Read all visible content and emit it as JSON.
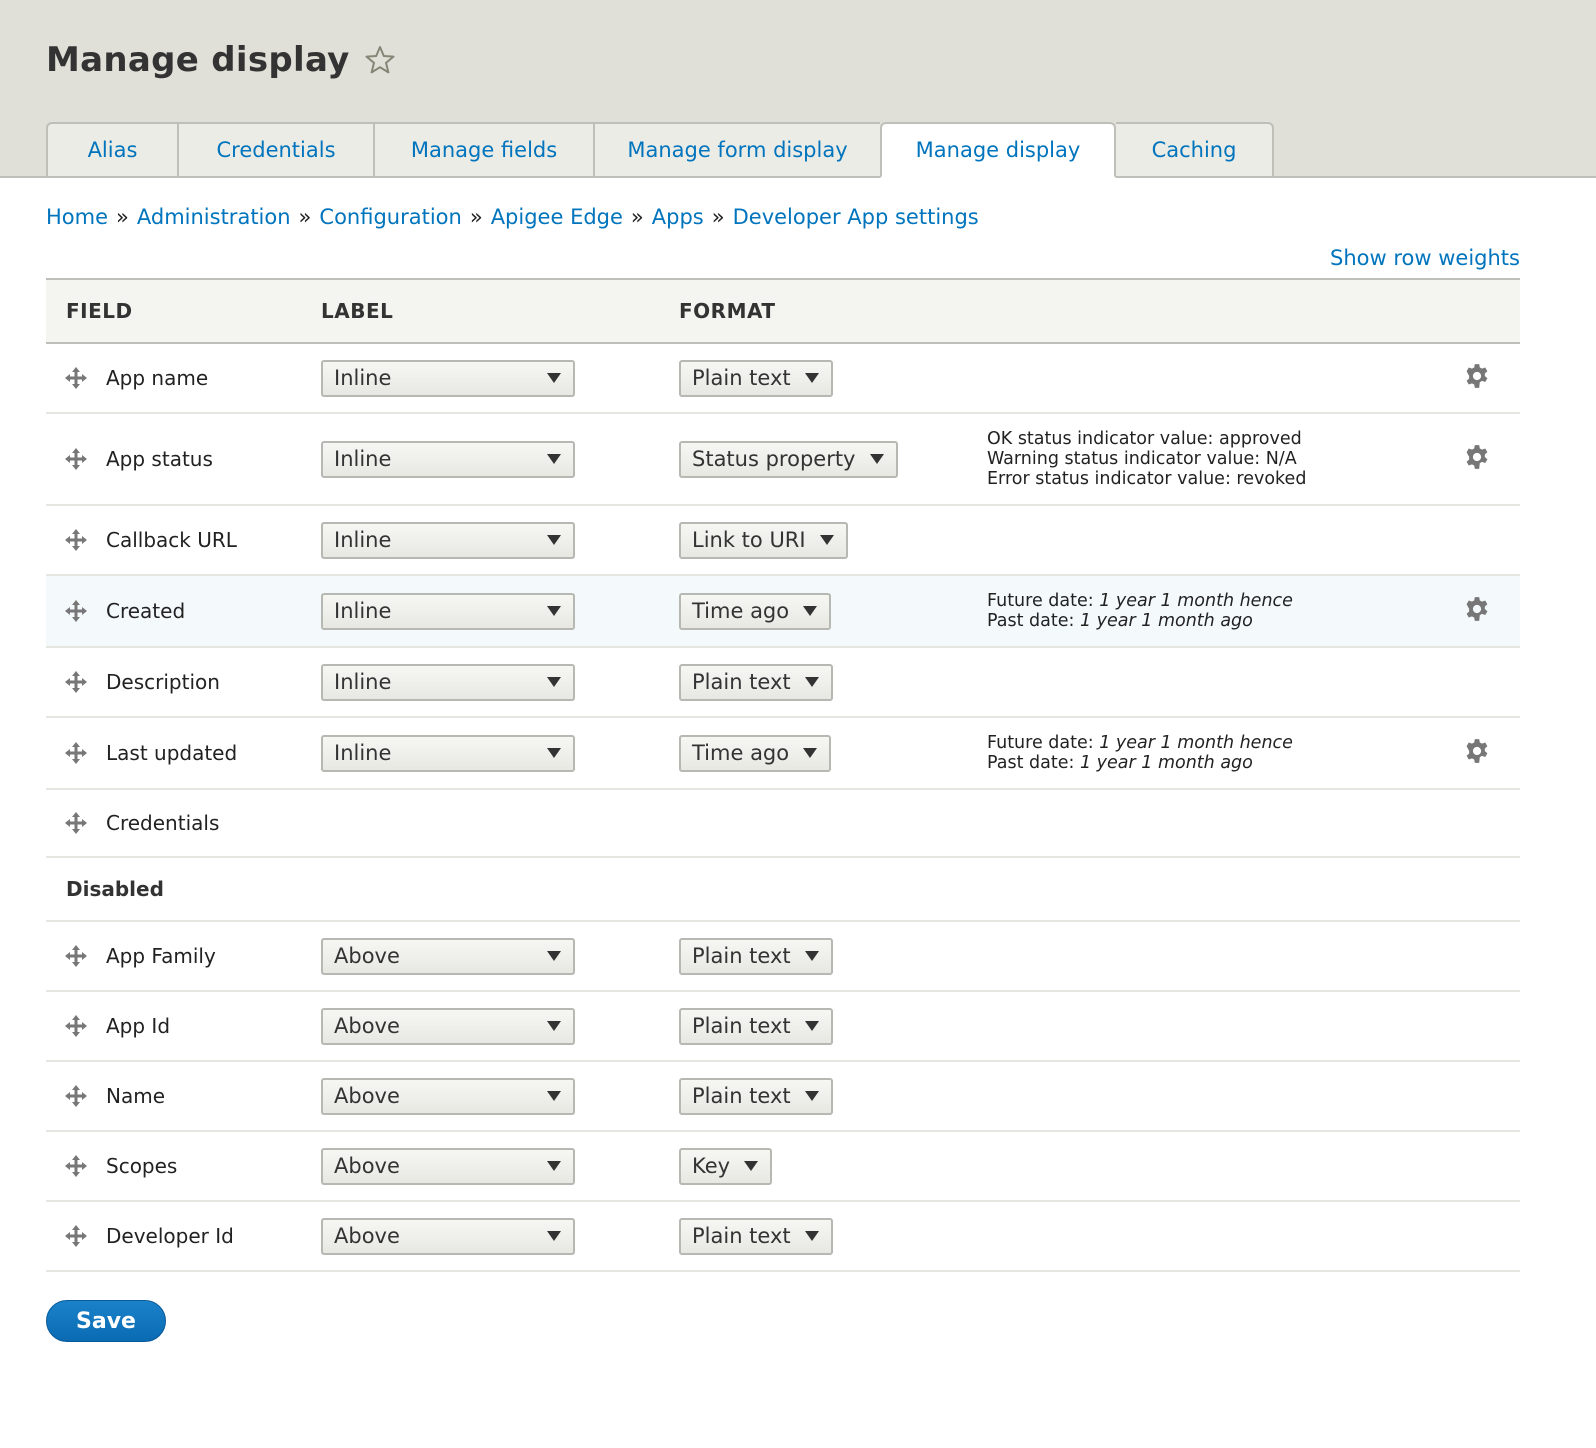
{
  "header": {
    "title": "Manage display",
    "star_icon": "star-outline-icon"
  },
  "tabs": [
    {
      "label": "Alias",
      "active": false
    },
    {
      "label": "Credentials",
      "active": false
    },
    {
      "label": "Manage fields",
      "active": false
    },
    {
      "label": "Manage form display",
      "active": false
    },
    {
      "label": "Manage display",
      "active": true
    },
    {
      "label": "Caching",
      "active": false
    }
  ],
  "breadcrumb": [
    "Home",
    "Administration",
    "Configuration",
    "Apigee Edge",
    "Apps",
    "Developer App settings"
  ],
  "breadcrumb_separator": "»",
  "show_row_weights": "Show row weights",
  "table": {
    "headers": {
      "field": "FIELD",
      "label": "LABEL",
      "format": "FORMAT"
    },
    "enabled_rows": [
      {
        "field": "App name",
        "label": "Inline",
        "format": "Plain text",
        "summary": [],
        "has_settings": true
      },
      {
        "field": "App status",
        "label": "Inline",
        "format": "Status property",
        "summary": [
          "OK status indicator value: approved",
          "Warning status indicator value: N/A",
          "Error status indicator value: revoked"
        ],
        "has_settings": true
      },
      {
        "field": "Callback URL",
        "label": "Inline",
        "format": "Link to URI",
        "summary": [],
        "has_settings": false
      },
      {
        "field": "Created",
        "label": "Inline",
        "format": "Time ago",
        "summary_dates": {
          "future_label": "Future date:",
          "future_value": "1 year 1 month hence",
          "past_label": "Past date:",
          "past_value": "1 year 1 month ago"
        },
        "has_settings": true,
        "highlight": true
      },
      {
        "field": "Description",
        "label": "Inline",
        "format": "Plain text",
        "summary": [],
        "has_settings": false
      },
      {
        "field": "Last updated",
        "label": "Inline",
        "format": "Time ago",
        "summary_dates": {
          "future_label": "Future date:",
          "future_value": "1 year 1 month hence",
          "past_label": "Past date:",
          "past_value": "1 year 1 month ago"
        },
        "has_settings": true
      },
      {
        "field": "Credentials",
        "label": null,
        "format": null,
        "summary": [],
        "has_settings": false
      }
    ],
    "disabled_region_title": "Disabled",
    "disabled_rows": [
      {
        "field": "App Family",
        "label": "Above",
        "format": "Plain text"
      },
      {
        "field": "App Id",
        "label": "Above",
        "format": "Plain text"
      },
      {
        "field": "Name",
        "label": "Above",
        "format": "Plain text"
      },
      {
        "field": "Scopes",
        "label": "Above",
        "format": "Key"
      },
      {
        "field": "Developer Id",
        "label": "Above",
        "format": "Plain text"
      }
    ]
  },
  "save_button": "Save",
  "colors": {
    "link": "#0074bd",
    "header_bg": "#e0e0d8",
    "primary_button": "#0a6bb3",
    "highlight_row": "#f4f9fc"
  }
}
